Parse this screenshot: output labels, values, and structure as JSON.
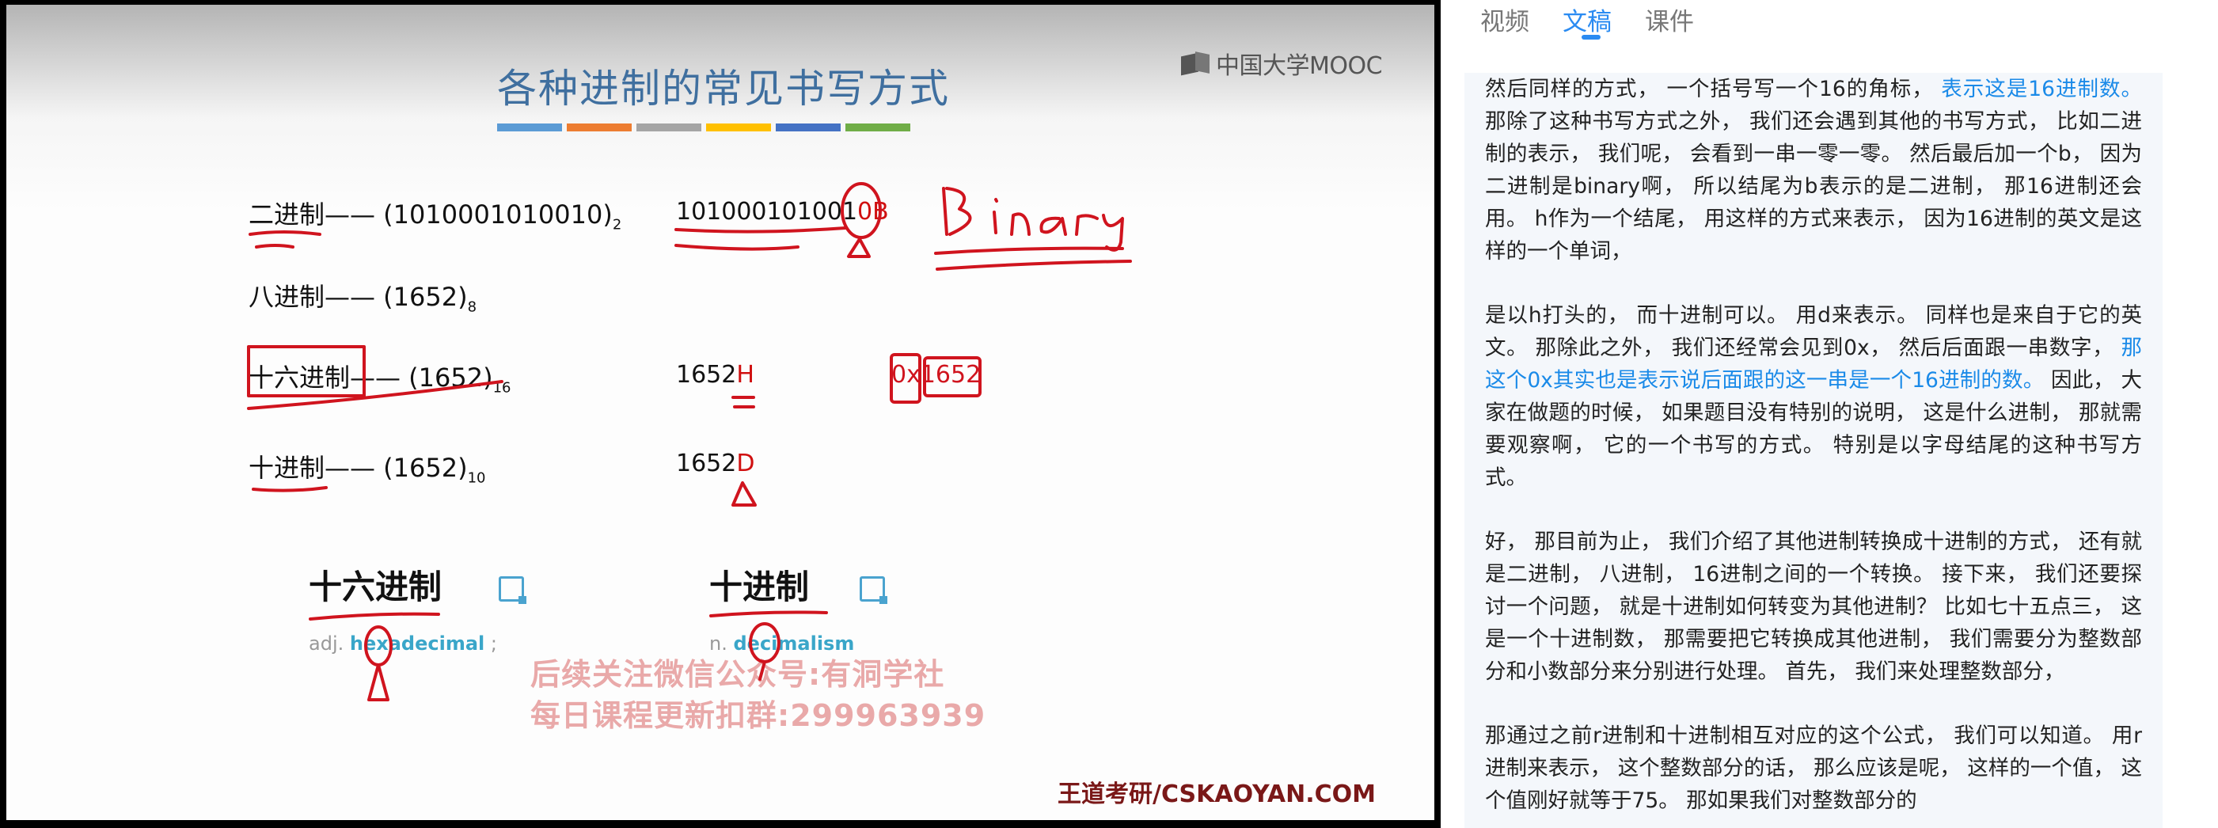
{
  "video": {
    "slide_title": "各种进制的常见书写方式",
    "logo_text": "中国大学MOOC",
    "title_bar_colors": [
      "#5b9bd5",
      "#ed7d31",
      "#a5a5a5",
      "#ffc000",
      "#4472c4",
      "#70ad47"
    ],
    "rows": [
      {
        "label": "二进制—— (1010001010010)",
        "sub": "2",
        "alt_prefix": "101000101001",
        "alt_marked": "0B",
        "alt_suffix": ""
      },
      {
        "label": "八进制—— (1652)",
        "sub": "8",
        "alt_prefix": "",
        "alt_marked": "",
        "alt_suffix": ""
      },
      {
        "label": "十六进制—— (1652)",
        "sub": "16",
        "alt_prefix": "1652",
        "alt_marked": "H",
        "alt_suffix": ""
      },
      {
        "label": "十进制—— (1652)",
        "sub": "10",
        "alt_prefix": "1652",
        "alt_marked": "D",
        "alt_suffix": ""
      }
    ],
    "hex_handwritten": "0x1652",
    "binary_handwritten": "Binary",
    "vocab_hex": {
      "zh": "十六进制",
      "pos": "adj.",
      "word": "hexadecimal",
      "tail": " ;"
    },
    "vocab_dec": {
      "zh": "十进制",
      "pos": "n.",
      "word": "decimalism",
      "tail": ""
    },
    "watermark_line1": "后续关注微信公众号:有洞学社",
    "watermark_line2": "每日课程更新扣群:299963939",
    "footer_brand": "王道考研/CSKAOYAN.COM",
    "annotation_color": "#d0141e"
  },
  "panel": {
    "tabs": [
      {
        "label": "视频"
      },
      {
        "label": "文稿"
      },
      {
        "label": "课件"
      }
    ],
    "active_tab": "文稿",
    "paragraphs": [
      {
        "before": "然后同样的方式， 一个括号写一个16的角标， ",
        "highlight": "表示这是16进制数。",
        "after": " 那除了这种书写方式之外， 我们还会遇到其他的书写方式， 比如二进制的表示， 我们呢， 会看到一串一零一零。 然后最后加一个b， 因为二进制是binary啊， 所以结尾为b表示的是二进制， 那16进制还会用。 h作为一个结尾， 用这样的方式来表示， 因为16进制的英文是这样的一个单词，"
      },
      {
        "before": "是以h打头的， 而十进制可以。 用d来表示。 同样也是来自于它的英文。 那除此之外， 我们还经常会见到0x， 然后后面跟一串数字， ",
        "highlight": "那这个0x其实也是表示说后面跟的这一串是一个16进制的数。",
        "after": " 因此， 大家在做题的时候， 如果题目没有特别的说明， 这是什么进制， 那就需要观察啊， 它的一个书写的方式。 特别是以字母结尾的这种书写方式。"
      },
      {
        "before": "好， 那目前为止， 我们介绍了其他进制转换成十进制的方式， 还有就是二进制， 八进制， 16进制之间的一个转换。 接下来， 我们还要探讨一个问题， 就是十进制如何转变为其他进制？ 比如七十五点三， 这是一个十进制数， 那需要把它转换成其他进制， 我们需要分为整数部分和小数部分来分别进行处理。 首先， 我们来处理整数部分，",
        "highlight": "",
        "after": ""
      },
      {
        "before": "那通过之前r进制和十进制相互对应的这个公式， 我们可以知道。 用r进制来表示， 这个整数部分的话， 那么应该是呢， 这样的一个值， 这个值刚好就等于75。 那如果我们对整数部分的",
        "highlight": "",
        "after": ""
      }
    ]
  }
}
